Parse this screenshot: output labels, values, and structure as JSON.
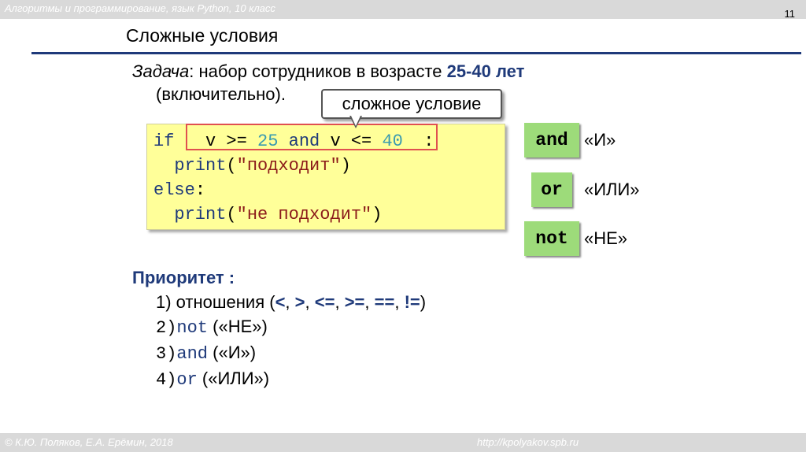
{
  "header": {
    "course": "Алгоритмы и программирование, язык Python, 10 класс",
    "slide_number": "11"
  },
  "slide": {
    "title": "Сложные условия",
    "task": {
      "label": "Задача",
      "text_before": ": набор сотрудников в возрасте ",
      "range": "25-40 лет",
      "text_line2": "(включительно)."
    },
    "callout": "сложное условие",
    "code": {
      "if_kw": "if",
      "cond_var1": "v",
      "cond_op1": ">=",
      "cond_num1": "25",
      "cond_and": "and",
      "cond_var2": "v",
      "cond_op2": "<=",
      "cond_num2": "40",
      "colon": ":",
      "print1_fn": "print",
      "print1_str": "\"подходит\"",
      "else_kw": "else",
      "else_colon": ":",
      "print2_fn": "print",
      "print2_str": "\"не подходит\""
    },
    "operators": [
      {
        "op": "and",
        "meaning": "«И»"
      },
      {
        "op": "or",
        "meaning": "«ИЛИ»"
      },
      {
        "op": "not",
        "meaning": "«НЕ»"
      }
    ],
    "priority": {
      "heading": "Приоритет :",
      "item1_prefix": "1) отношения (",
      "item1_ops": [
        "<",
        ">",
        "<=",
        ">=",
        "==",
        "!="
      ],
      "item1_suffix": ")",
      "item2_num": "2)",
      "item2_op": "not",
      "item2_text": " («НЕ»)",
      "item3_num": "3)",
      "item3_op": "and",
      "item3_text": " («И»)",
      "item4_num": "4)",
      "item4_op": "or",
      "item4_text": " («ИЛИ»)"
    }
  },
  "footer": {
    "copyright": "© К.Ю. Поляков, Е.А. Ерёмин, 2018",
    "site": "http://kpolyakov.spb.ru"
  }
}
